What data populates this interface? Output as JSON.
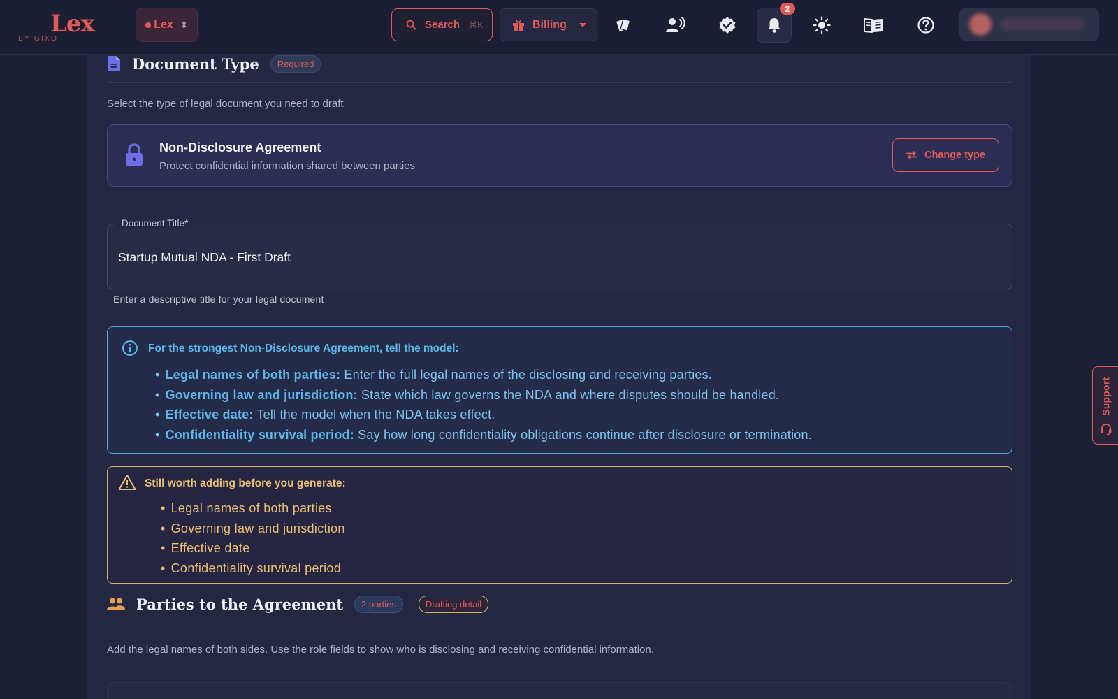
{
  "brand": {
    "name": "Lex",
    "sub": "BY GIXO"
  },
  "topbar": {
    "workspace_label": "Lex",
    "search_label": "Search",
    "search_shortcut": "⌘K",
    "billing_label": "Billing",
    "notification_count": "2"
  },
  "document_type": {
    "title": "Document Type",
    "badge": "Required",
    "description": "Select the type of legal document you need to draft",
    "selected_name": "Non-Disclosure Agreement",
    "selected_desc": "Protect confidential information shared between parties",
    "change_label": "Change type"
  },
  "title_field": {
    "label": "Document Title*",
    "value": "Startup Mutual NDA - First Draft",
    "helper": "Enter a descriptive title for your legal document"
  },
  "tips": {
    "heading": "For the strongest Non-Disclosure Agreement, tell the model:",
    "items": [
      {
        "term": "Legal names of both parties:",
        "text": " Enter the full legal names of the disclosing and receiving parties."
      },
      {
        "term": "Governing law and jurisdiction:",
        "text": " State which law governs the NDA and where disputes should be handled."
      },
      {
        "term": "Effective date:",
        "text": " Tell the model when the NDA takes effect."
      },
      {
        "term": "Confidentiality survival period:",
        "text": " Say how long confidentiality obligations continue after disclosure or termination."
      }
    ]
  },
  "warning": {
    "heading": "Still worth adding before you generate:",
    "items": [
      "Legal names of both parties",
      "Governing law and jurisdiction",
      "Effective date",
      "Confidentiality survival period"
    ]
  },
  "parties": {
    "title": "Parties to the Agreement",
    "count_badge": "2 parties",
    "detail_badge": "Drafting detail",
    "description": "Add the legal names of both sides. Use the role fields to show who is disclosing and receiving confidential information."
  },
  "support_label": "Support",
  "colors": {
    "accent": "#e25a58",
    "info": "#5cb6ea",
    "warning": "#e8c074",
    "background": "#1c2036"
  }
}
